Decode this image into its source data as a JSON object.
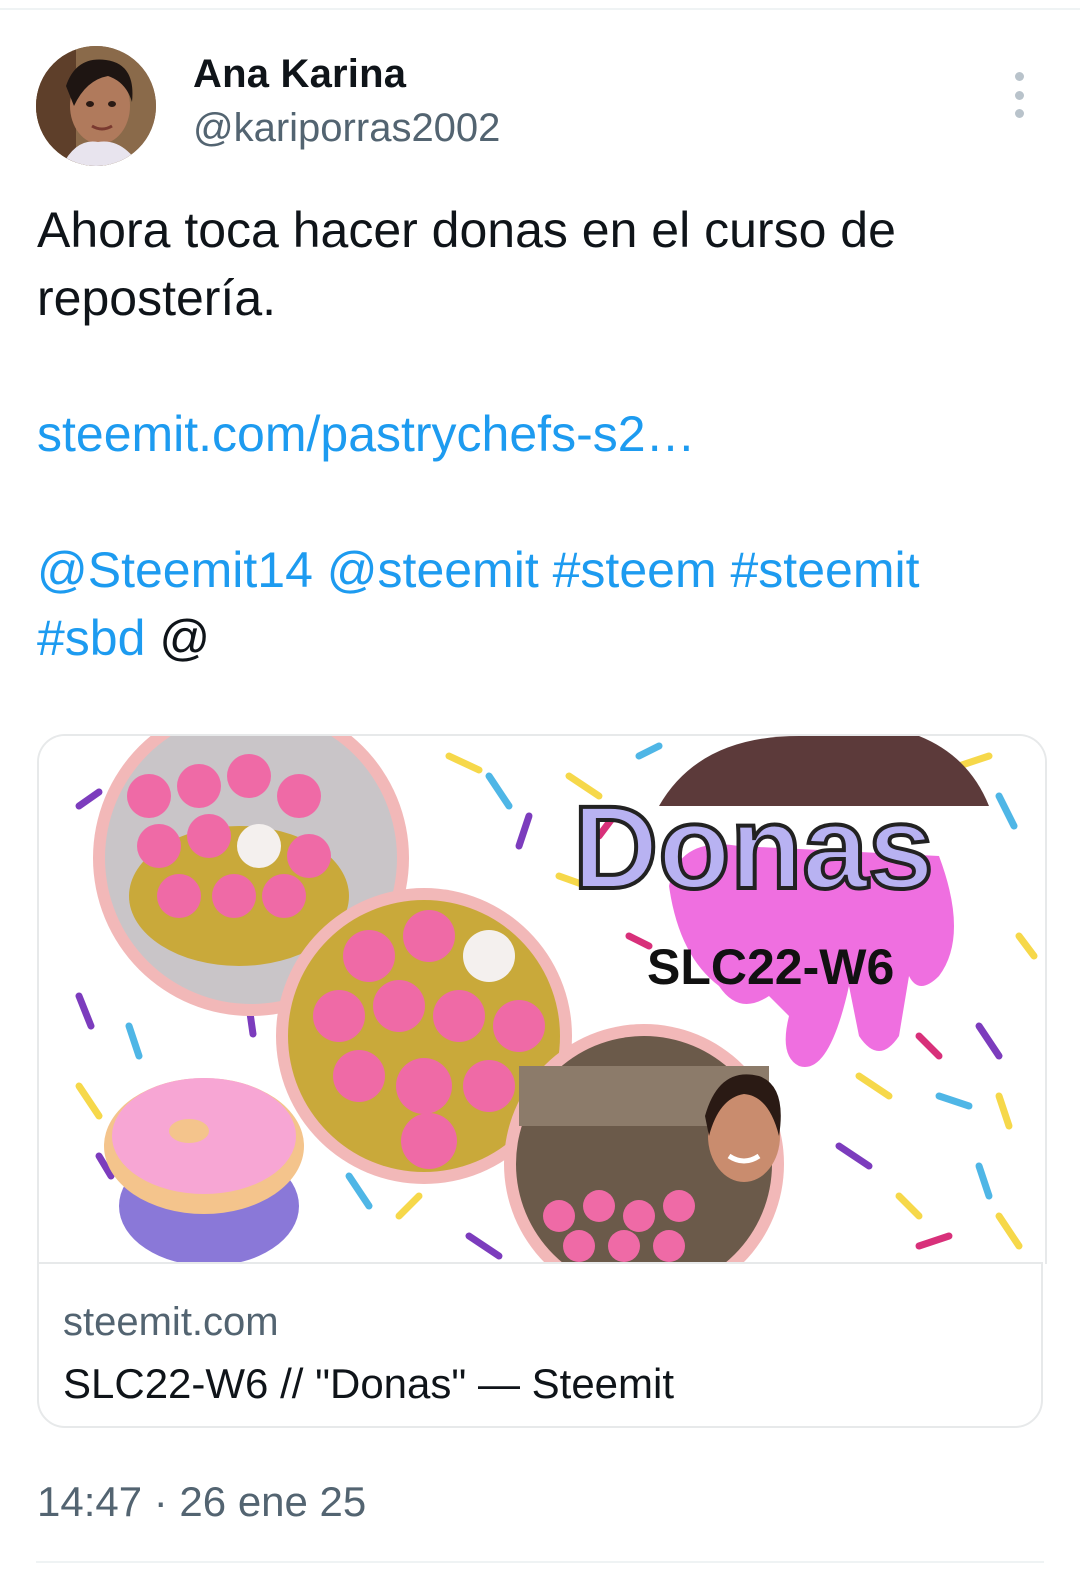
{
  "author": {
    "name": "Ana Karina",
    "handle": "@kariporras2002"
  },
  "tweet": {
    "line1": "Ahora toca hacer donas en el curso de",
    "line2": "repostería.",
    "link": "steemit.com/pastrychefs-s2…",
    "mention1": "@Steemit14",
    "mention2": "@steemit",
    "tag1": "#steem",
    "tag2": "#steemit",
    "tag3": "#sbd",
    "trailing_at": "@"
  },
  "card": {
    "image_title": "Donas",
    "image_code": "SLC22-W6",
    "domain": "steemit.com",
    "title": "SLC22-W6 // \"Donas\" — Steemit"
  },
  "timestamp": "14:47 · 26 ene 25",
  "colors": {
    "link": "#1d9bf0",
    "secondary_text": "#536471",
    "primary_text": "#0f1419",
    "border": "#e7e9ea"
  },
  "icons": {
    "more": "three-dots-vertical-icon"
  }
}
